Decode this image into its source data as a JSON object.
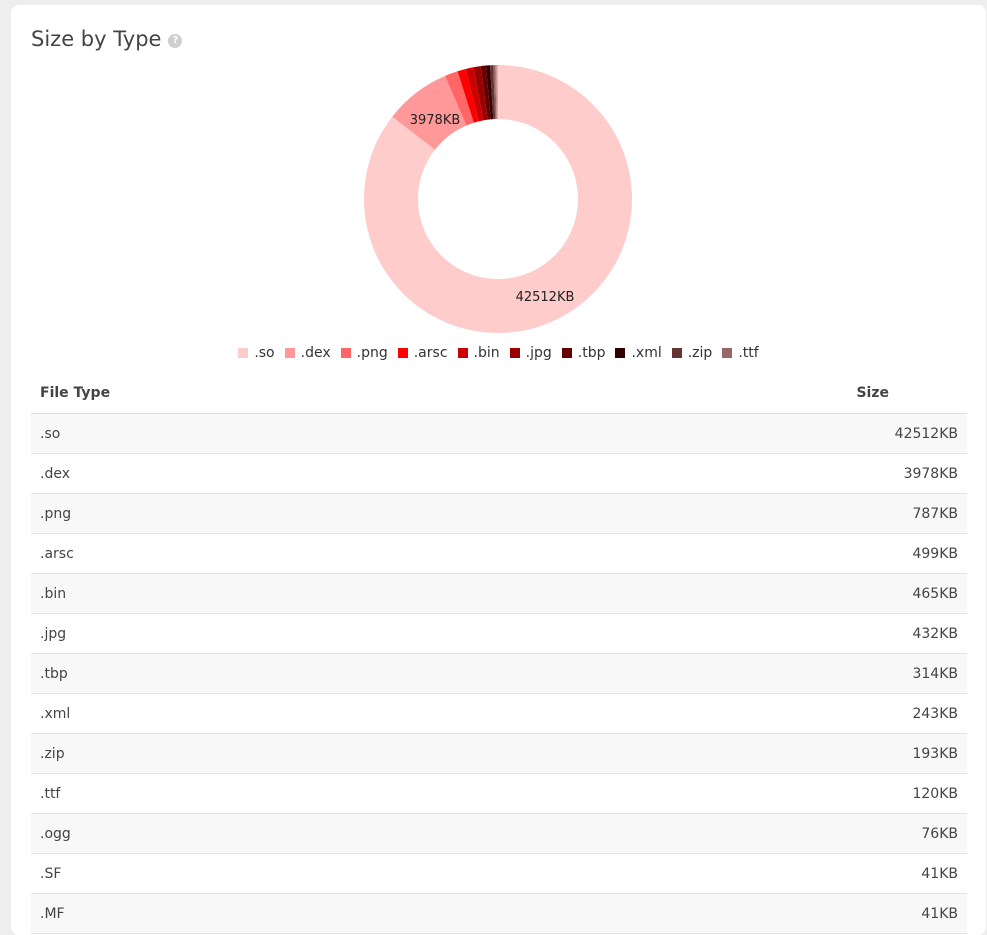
{
  "card": {
    "title": "Size by Type",
    "help_icon": "question-circle-icon"
  },
  "chart_data": {
    "type": "pie",
    "donut": true,
    "categories": [
      ".so",
      ".dex",
      ".png",
      ".arsc",
      ".bin",
      ".jpg",
      ".tbp",
      ".xml",
      ".zip",
      ".ttf",
      ".ogg",
      ".SF",
      ".MF"
    ],
    "values": [
      42512,
      3978,
      787,
      499,
      465,
      432,
      314,
      243,
      193,
      120,
      76,
      41,
      41
    ],
    "colors": [
      "#ffcccc",
      "#ff9999",
      "#ff6666",
      "#ff0000",
      "#cc0000",
      "#990000",
      "#660000",
      "#330000",
      "#663333",
      "#996666",
      "#bb8888",
      "#cc9999",
      "#ddaaaa"
    ],
    "data_labels": [
      "42512KB",
      "3978KB"
    ],
    "legend": [
      ".so",
      ".dex",
      ".png",
      ".arsc",
      ".bin",
      ".jpg",
      ".tbp",
      ".xml",
      ".zip",
      ".ttf"
    ],
    "legend_position": "bottom"
  },
  "table": {
    "headers": {
      "type": "File Type",
      "size": "Size"
    },
    "rows": [
      {
        "type": ".so",
        "size": "42512KB"
      },
      {
        "type": ".dex",
        "size": "3978KB"
      },
      {
        "type": ".png",
        "size": "787KB"
      },
      {
        "type": ".arsc",
        "size": "499KB"
      },
      {
        "type": ".bin",
        "size": "465KB"
      },
      {
        "type": ".jpg",
        "size": "432KB"
      },
      {
        "type": ".tbp",
        "size": "314KB"
      },
      {
        "type": ".xml",
        "size": "243KB"
      },
      {
        "type": ".zip",
        "size": "193KB"
      },
      {
        "type": ".ttf",
        "size": "120KB"
      },
      {
        "type": ".ogg",
        "size": "76KB"
      },
      {
        "type": ".SF",
        "size": "41KB"
      },
      {
        "type": ".MF",
        "size": "41KB"
      }
    ]
  }
}
